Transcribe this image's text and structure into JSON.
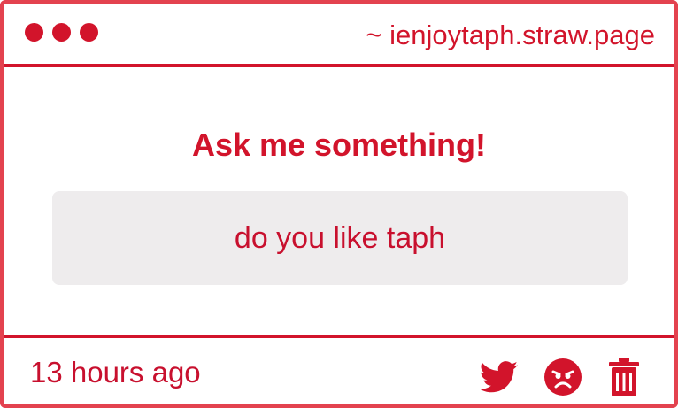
{
  "window": {
    "domain": "~ ienjoytaph.straw.page",
    "control_dots": [
      "red-dot",
      "red-dot",
      "red-dot"
    ]
  },
  "main": {
    "prompt": "Ask me something!",
    "question": "do you like taph"
  },
  "footer": {
    "timestamp": "13 hours ago",
    "actions": [
      "twitter-icon",
      "angry-face-icon",
      "trash-icon"
    ]
  },
  "colors": {
    "accent": "#d2142b",
    "border": "#e3424f",
    "question_background": "#eeeced",
    "background": "#ffffff"
  }
}
